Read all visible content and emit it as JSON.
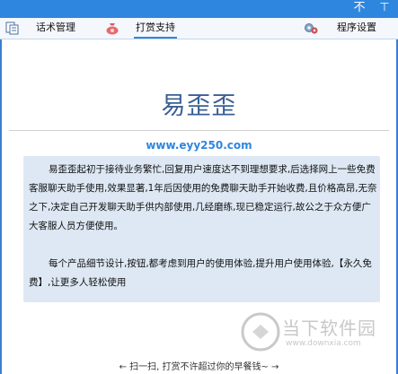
{
  "titlebar": {
    "pin_icon": "pin-icon",
    "close_icon": "close-icon",
    "pin_glyph": "不",
    "close_glyph": "⊤"
  },
  "tabs": {
    "script_mgmt": "话术管理",
    "donate": "打赏支持",
    "settings": "程序设置"
  },
  "app_title": "易歪歪",
  "site_url": "www.eyy250.com",
  "description": {
    "para1": "易歪歪起初于接待业务繁忙,回复用户速度达不到理想要求,后选择网上一些免费客服聊天助手使用,效果显著,1年后因使用的免费聊天助手开始收费,且价格高昂,无奈之下,决定自己开发聊天助手供内部使用,几经磨练,现已稳定运行,故公之于众方便广大客服人员方便使用。",
    "para2": "每个产品细节设计,按钮,都考虑到用户的使用体验,提升用户使用体验,【永久免费】,让更多人轻松使用"
  },
  "watermark": {
    "cn": "当下软件园",
    "url": "www.downxia.com"
  },
  "footer": "← 扫一扫, 打赏不许超过你的早餐钱~ →",
  "colors": {
    "accent": "#2f86df",
    "title": "#3a5f95",
    "box": "#dde8f4"
  }
}
